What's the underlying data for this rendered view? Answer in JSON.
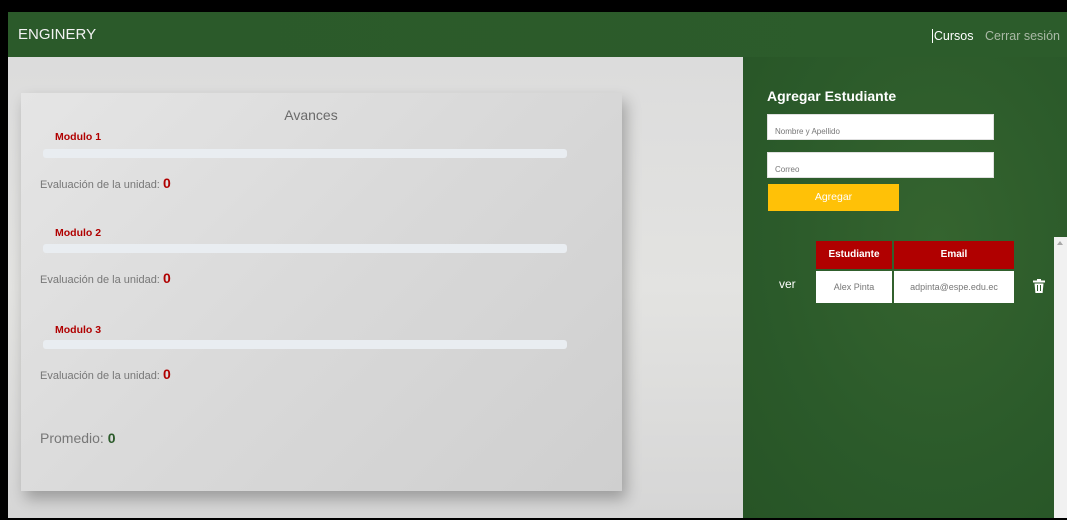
{
  "navbar": {
    "brand": "ENGINERY",
    "links": {
      "courses": "Cursos",
      "logout": "Cerrar sesión"
    }
  },
  "progress_card": {
    "title": "Avances",
    "eval_label": "Evaluación de la unidad:",
    "modules": [
      {
        "name": "Modulo 1",
        "progress": 0,
        "score": "0"
      },
      {
        "name": "Modulo 2",
        "progress": 0,
        "score": "0"
      },
      {
        "name": "Modulo 3",
        "progress": 0,
        "score": "0"
      }
    ],
    "average_label": "Promedio:",
    "average_value": "0"
  },
  "add_student": {
    "title": "Agregar Estudiante",
    "name_placeholder": "Nombre y Apellido",
    "email_placeholder": "Correo",
    "submit_label": "Agregar"
  },
  "students_table": {
    "columns": [
      "Estudiante",
      "Email"
    ],
    "rows": [
      {
        "action": "ver",
        "student": "Alex Pinta",
        "email": "adpinta@espe.edu.ec"
      }
    ]
  },
  "icons": {
    "delete": "trash-icon",
    "scroll_up": "arrow-up-icon"
  },
  "colors": {
    "primary": "#2b5a2a",
    "accent_red": "#b00000",
    "button_yellow": "#ffc107"
  }
}
